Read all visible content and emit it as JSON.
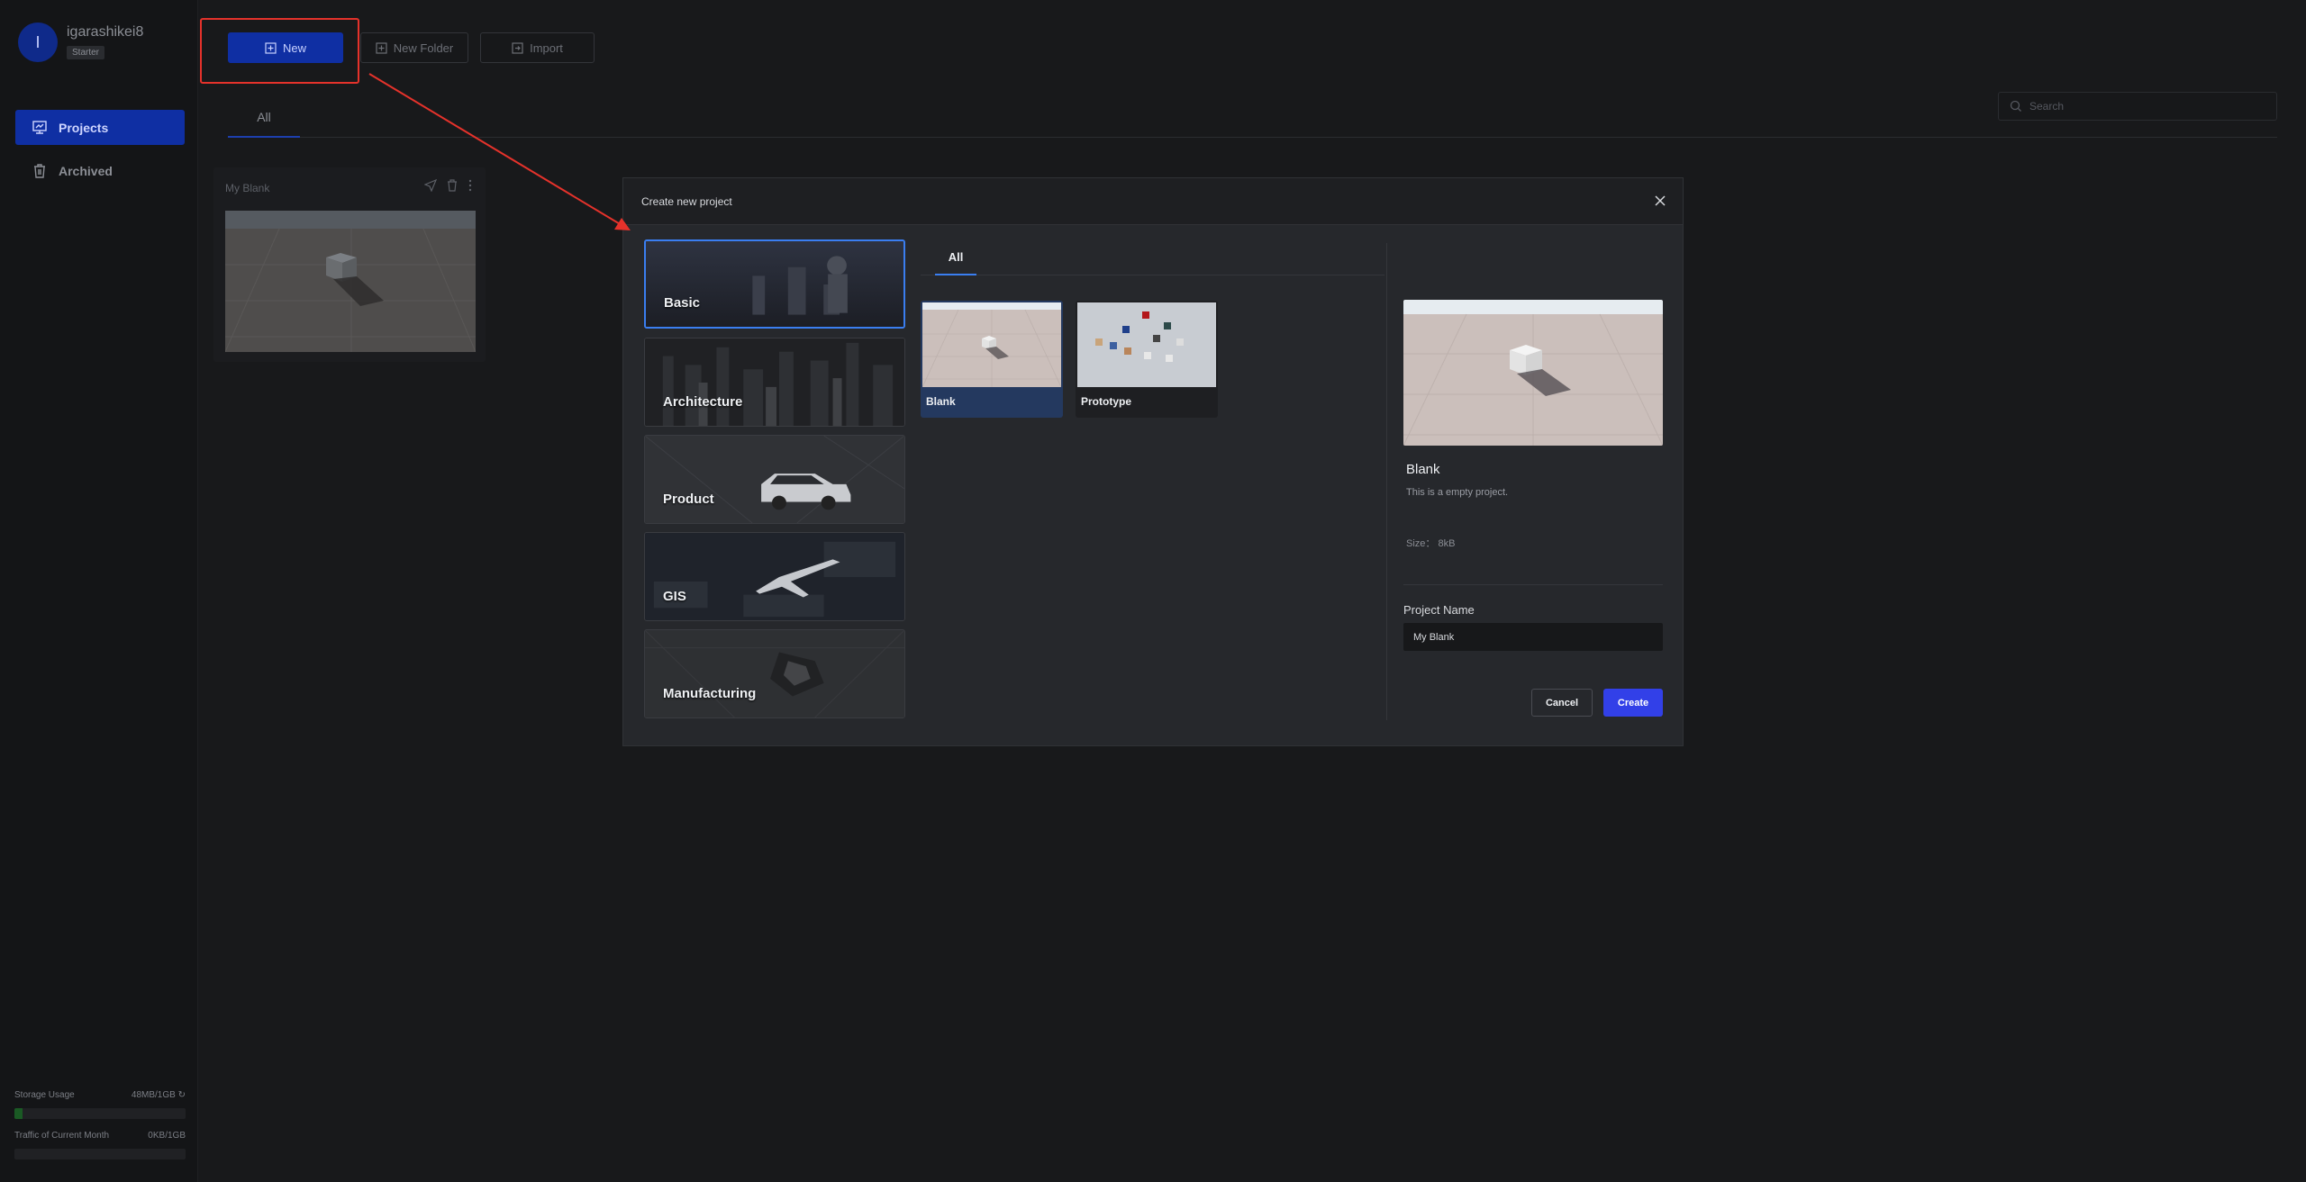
{
  "user": {
    "initial": "I",
    "name": "igarashikei8",
    "plan": "Starter"
  },
  "sidebar": {
    "items": [
      {
        "label": "Projects",
        "icon": "projects-icon",
        "active": true
      },
      {
        "label": "Archived",
        "icon": "trash-icon",
        "active": false
      }
    ],
    "storage": {
      "label": "Storage Usage",
      "value": "48MB/1GB",
      "fraction": 0.047
    },
    "traffic": {
      "label": "Traffic of Current Month",
      "value": "0KB/1GB",
      "fraction": 0
    }
  },
  "toolbar": {
    "new_label": "New",
    "new_folder_label": "New Folder",
    "import_label": "Import"
  },
  "main": {
    "tab_all": "All",
    "search_placeholder": "Search"
  },
  "project_card": {
    "title": "My Blank"
  },
  "modal": {
    "title": "Create new project",
    "categories": [
      "Basic",
      "Architecture",
      "Product",
      "GIS",
      "Manufacturing"
    ],
    "selected_category": "Basic",
    "tab_all": "All",
    "templates": [
      {
        "label": "Blank",
        "selected": true
      },
      {
        "label": "Prototype",
        "selected": false
      }
    ],
    "preview": {
      "name": "Blank",
      "description": "This is a empty project.",
      "size": "Size：  8kB"
    },
    "project_name_label": "Project Name",
    "project_name_value": "My Blank",
    "cancel_label": "Cancel",
    "create_label": "Create"
  },
  "colors": {
    "accent": "#3240e8",
    "sidebar_active": "#0f2fa3",
    "annotation": "#e5322b",
    "selected_border": "#3a7ef0"
  }
}
